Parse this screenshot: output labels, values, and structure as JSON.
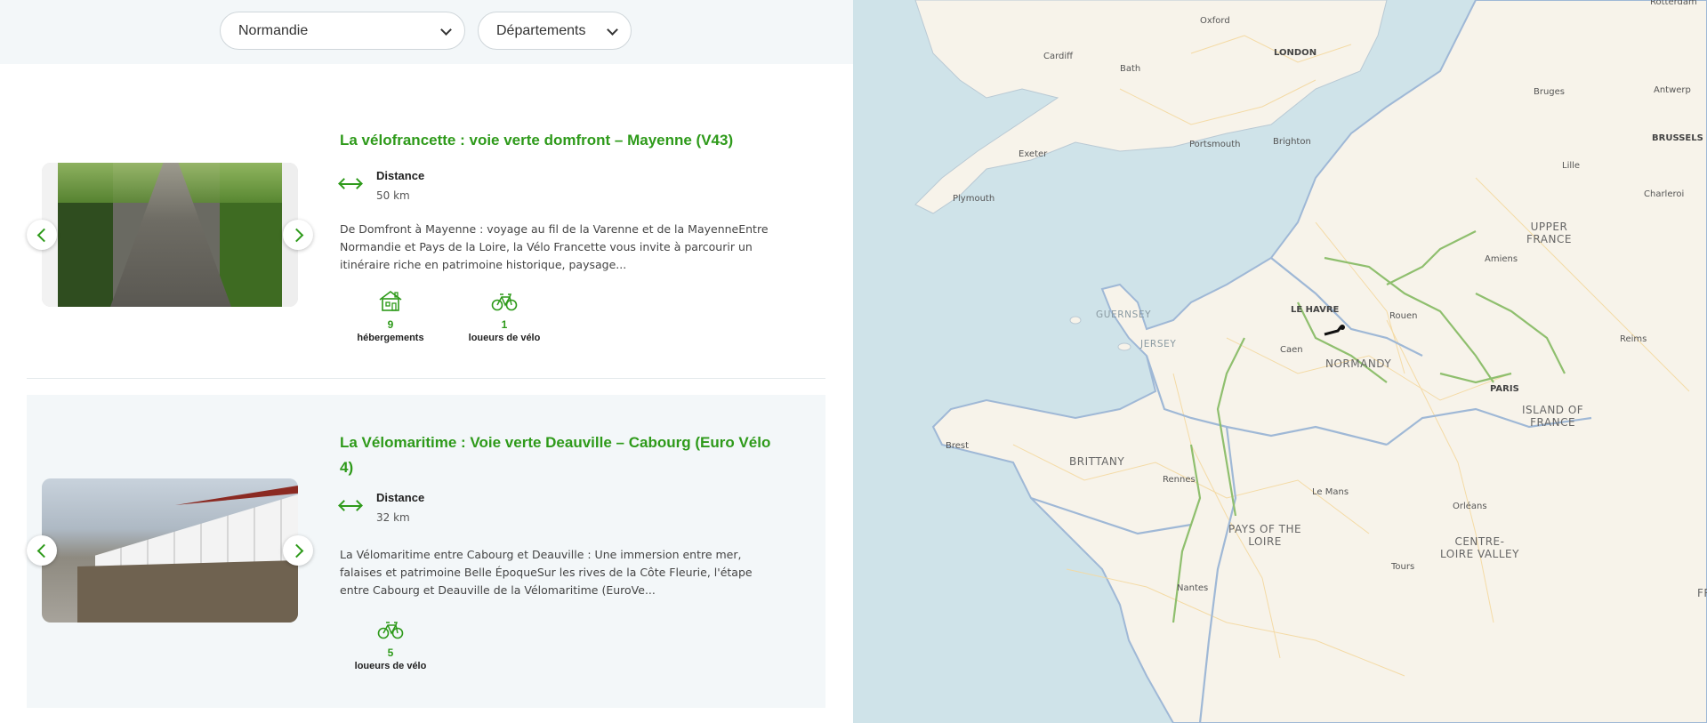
{
  "filters": {
    "region": "Normandie",
    "departments": "Départements"
  },
  "cards": [
    {
      "title": "La vélofrancette : voie verte domfront – Mayenne (V43)",
      "distance_label": "Distance",
      "distance_value": "50 km",
      "description": "De Domfront à Mayenne : voyage au fil de la Varenne et de la MayenneEntre Normandie et Pays de la Loire, la Vélo Francette vous invite à parcourir un itinéraire riche en patrimoine historique, paysage...",
      "stats": [
        {
          "icon": "house-icon",
          "count": "9",
          "label": "hébergements"
        },
        {
          "icon": "bicycle-icon",
          "count": "1",
          "label": "loueurs de vélo"
        }
      ]
    },
    {
      "title": "La Vélomaritime : Voie verte Deauville – Cabourg (Euro Vélo 4)",
      "distance_label": "Distance",
      "distance_value": "32 km",
      "description": "La Vélomaritime entre Cabourg et Deauville : Une immersion entre mer, falaises et patrimoine Belle ÉpoqueSur les rives de la Côte Fleurie, l'étape entre Cabourg et Deauville de la Vélomaritime (EuroVe...",
      "stats": [
        {
          "icon": "bicycle-icon",
          "count": "5",
          "label": "loueurs de vélo"
        }
      ]
    }
  ],
  "map": {
    "labels": {
      "rotterdam": "Rotterdam",
      "oxford": "Oxford",
      "london": "LONDON",
      "cardiff": "Cardiff",
      "bath": "Bath",
      "antwerp": "Antwerp",
      "bruges": "Bruges",
      "brussels": "BRUSSELS",
      "exeter": "Exeter",
      "portsmouth": "Portsmouth",
      "brighton": "Brighton",
      "lille": "Lille",
      "plymouth": "Plymouth",
      "charleroi": "Charleroi",
      "upper_france": "UPPER\nFRANCE",
      "amiens": "Amiens",
      "guernsey": "GUERNSEY",
      "le_havre": "LE HAVRE",
      "rouen": "Rouen",
      "jersey": "JERSEY",
      "caen": "Caen",
      "normandy": "NORMANDY",
      "reims": "Reims",
      "paris": "PARIS",
      "island_of_france": "ISLAND OF\nFRANCE",
      "brest": "Brest",
      "brittany": "BRITTANY",
      "rennes": "Rennes",
      "le_mans": "Le Mans",
      "orleans": "Orléans",
      "pays_de_la_loire": "PAYS OF THE\nLOIRE",
      "centre": "CENTRE-\nLOIRE VALLEY",
      "tours": "Tours",
      "nantes": "Nantes",
      "fr": "FR"
    },
    "colors": {
      "sea": "#cfe3e9",
      "land": "#f7f3ea",
      "route_green": "#8fbf6e",
      "boundary": "#9fb8d6"
    }
  }
}
